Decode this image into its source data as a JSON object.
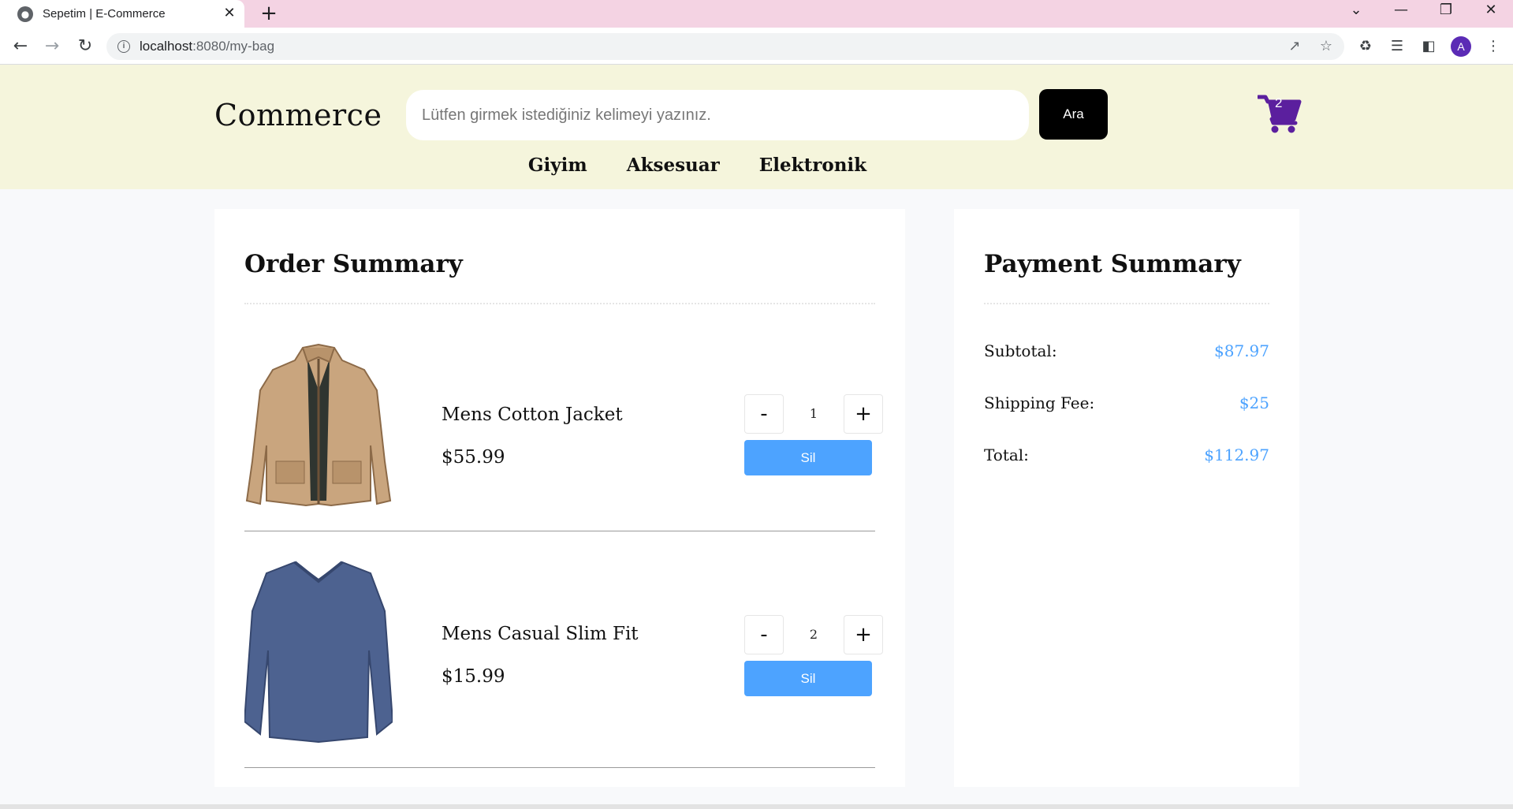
{
  "browser": {
    "tab_title": "Sepetim | E-Commerce",
    "url_host": "localhost",
    "url_path": ":8080/my-bag",
    "profile_initial": "A"
  },
  "site": {
    "logo": "Commerce",
    "search_placeholder": "Lütfen girmek istediğiniz kelimeyi yazınız.",
    "search_button": "Ara",
    "cart_count": "2",
    "categories": [
      "Giyim",
      "Aksesuar",
      "Elektronik"
    ]
  },
  "order": {
    "title": "Order Summary",
    "items": [
      {
        "name": "Mens Cotton Jacket",
        "price": "$55.99",
        "quantity": "1",
        "minus": "-",
        "plus": "+",
        "remove": "Sil",
        "image": "jacket-image"
      },
      {
        "name": "Mens Casual Slim Fit",
        "price": "$15.99",
        "quantity": "2",
        "minus": "-",
        "plus": "+",
        "remove": "Sil",
        "image": "sweater-image"
      }
    ]
  },
  "payment": {
    "title": "Payment Summary",
    "subtotal_label": "Subtotal:",
    "subtotal_value": "$87.97",
    "shipping_label": "Shipping Fee:",
    "shipping_value": "$25",
    "total_label": "Total:",
    "total_value": "$112.97"
  },
  "colors": {
    "header_bg": "#f5f5dc",
    "tabbar_bg": "#f4d3e3",
    "accent_blue": "#4da3ff",
    "cart_purple": "#5b1f9e"
  }
}
